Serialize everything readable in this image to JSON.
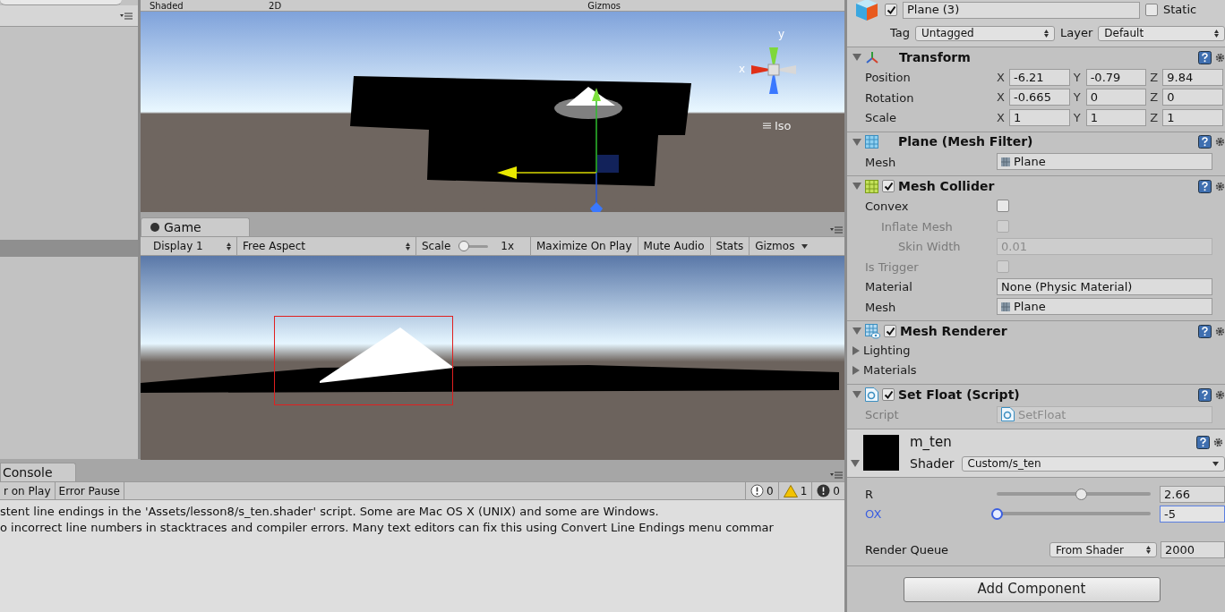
{
  "scene": {
    "toolbar": {
      "draw_mode": "Shaded",
      "mode_2d": "2D",
      "gizmos": "Gizmos"
    },
    "axis_y": "y",
    "axis_x": "x",
    "projection": "Iso"
  },
  "game": {
    "tab": "Game",
    "toolbar": [
      {
        "kind": "dropdown",
        "label": "Display 1"
      },
      {
        "kind": "dropdown",
        "label": "Free Aspect"
      },
      {
        "kind": "scale",
        "label": "Scale",
        "value": "1x",
        "level": 0.1
      },
      {
        "kind": "toggle",
        "label": "Maximize On Play"
      },
      {
        "kind": "toggle",
        "label": "Mute Audio"
      },
      {
        "kind": "toggle",
        "label": "Stats"
      },
      {
        "kind": "menu",
        "label": "Gizmos"
      }
    ]
  },
  "console": {
    "tab": "Console",
    "buttons": [
      "r on Play",
      "Error Pause"
    ],
    "counts": [
      {
        "kind": "info",
        "value": "0"
      },
      {
        "kind": "warning",
        "value": "1"
      },
      {
        "kind": "error",
        "value": "0"
      }
    ],
    "messages": [
      "stent line endings in the 'Assets/lesson8/s_ten.shader' script. Some are Mac OS X (UNIX) and some are Windows.",
      "o incorrect line numbers in stacktraces and compiler errors. Many text editors can fix this using Convert Line Endings menu commar"
    ]
  },
  "inspector": {
    "object": {
      "active": true,
      "name": "Plane (3)",
      "static": false,
      "static_label": "Static",
      "tag_label": "Tag",
      "tag": "Untagged",
      "layer_label": "Layer",
      "layer": "Default"
    },
    "components": [
      {
        "kind": "transform",
        "title": "Transform",
        "rows": [
          {
            "kind": "vector3",
            "label": "Position",
            "fields": [
              {
                "axis": "X",
                "value": "-6.21"
              },
              {
                "axis": "Y",
                "value": "-0.79"
              },
              {
                "axis": "Z",
                "value": "9.84"
              }
            ]
          },
          {
            "kind": "vector3",
            "label": "Rotation",
            "fields": [
              {
                "axis": "X",
                "value": "-0.665"
              },
              {
                "axis": "Y",
                "value": "0"
              },
              {
                "axis": "Z",
                "value": "0"
              }
            ]
          },
          {
            "kind": "vector3",
            "label": "Scale",
            "fields": [
              {
                "axis": "X",
                "value": "1"
              },
              {
                "axis": "Y",
                "value": "1"
              },
              {
                "axis": "Z",
                "value": "1"
              }
            ]
          }
        ]
      },
      {
        "kind": "mesh_filter",
        "title": "Plane (Mesh Filter)",
        "rows": [
          {
            "kind": "object",
            "label": "Mesh",
            "value": "Plane",
            "disabled": false
          }
        ]
      },
      {
        "kind": "mesh_collider",
        "title": "Mesh Collider",
        "enabled": true,
        "rows": [
          {
            "kind": "checkbox",
            "label": "Convex",
            "checked": false,
            "disabled": false,
            "children": [
              {
                "kind": "checkbox",
                "label": "Inflate Mesh",
                "checked": false,
                "disabled": true,
                "children": [
                  {
                    "kind": "text",
                    "label": "Skin Width",
                    "value": "0.01",
                    "disabled": true
                  }
                ]
              }
            ]
          },
          {
            "kind": "checkbox",
            "label": "Is Trigger",
            "checked": false,
            "disabled": true
          },
          {
            "kind": "text",
            "label": "Material",
            "value": "None (Physic Material)",
            "disabled": false
          },
          {
            "kind": "object",
            "label": "Mesh",
            "value": "Plane",
            "disabled": false
          }
        ]
      },
      {
        "kind": "mesh_renderer",
        "title": "Mesh Renderer",
        "enabled": true,
        "rows": [
          {
            "kind": "foldout",
            "label": "Lighting",
            "expanded": false
          },
          {
            "kind": "foldout",
            "label": "Materials",
            "expanded": false
          }
        ]
      },
      {
        "kind": "script",
        "title": "Set Float (Script)",
        "enabled": true,
        "rows": [
          {
            "kind": "script",
            "label": "Script",
            "value": "SetFloat",
            "disabled": true
          }
        ]
      }
    ],
    "material": {
      "name": "m_ten",
      "shader_label": "Shader",
      "shader": "Custom/s_ten",
      "properties": [
        {
          "label": "R",
          "value": "2.66",
          "level": 0.55,
          "focused": false
        },
        {
          "label": "OX",
          "value": "-5",
          "level": 0,
          "focused": true
        }
      ],
      "render_queue_label": "Render Queue",
      "render_queue_mode": "From Shader",
      "render_queue": "2000"
    },
    "add_component": "Add Component"
  }
}
